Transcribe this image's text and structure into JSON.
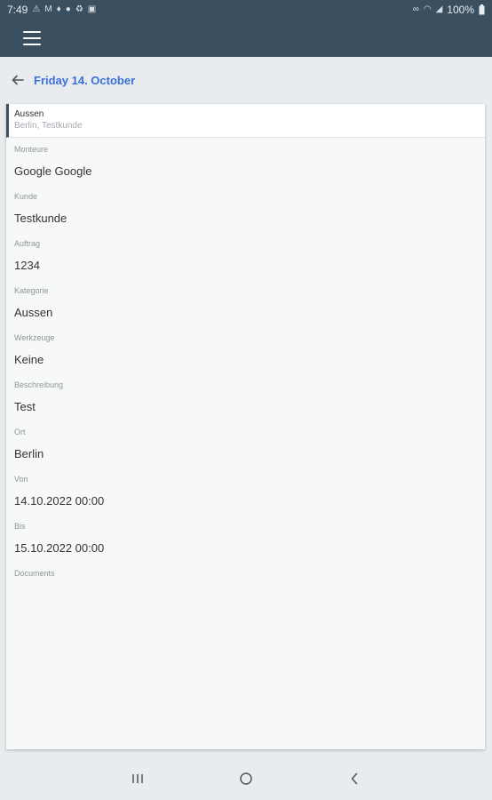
{
  "status_bar": {
    "time": "7:49",
    "battery": "100%"
  },
  "header": {
    "date_title": "Friday 14. October"
  },
  "card": {
    "title": "Aussen",
    "subtitle": "Berlin, Testkunde"
  },
  "fields": [
    {
      "label": "Monteure",
      "value": "Google Google"
    },
    {
      "label": "Kunde",
      "value": "Testkunde"
    },
    {
      "label": "Auftrag",
      "value": "1234"
    },
    {
      "label": "Kategorie",
      "value": "Aussen"
    },
    {
      "label": "Werkzeuge",
      "value": "Keine"
    },
    {
      "label": "Beschreibung",
      "value": "Test"
    },
    {
      "label": "Ort",
      "value": "Berlin"
    },
    {
      "label": "Von",
      "value": "14.10.2022 00:00"
    },
    {
      "label": "Bis",
      "value": "15.10.2022 00:00"
    },
    {
      "label": "Documents",
      "value": ""
    }
  ],
  "icons": {
    "menu": "hamburger-menu-icon",
    "back": "back-arrow-icon",
    "nav_recents": "recents-icon",
    "nav_home": "home-icon",
    "nav_back": "nav-back-icon"
  }
}
